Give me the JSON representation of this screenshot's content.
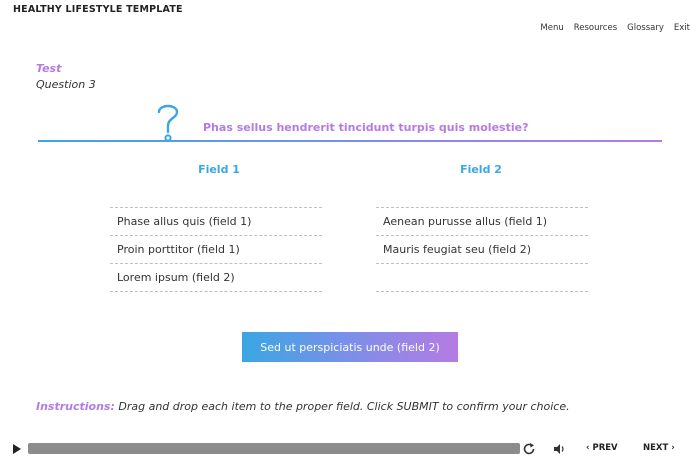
{
  "app": {
    "title": "HEALTHY LIFESTYLE TEMPLATE"
  },
  "nav": {
    "items": [
      "Menu",
      "Resources",
      "Glossary",
      "Exit"
    ]
  },
  "section": {
    "label": "Test",
    "question_number": "Question 3"
  },
  "question": {
    "text": "Phas sellus hendrerit tincidunt turpis quis molestie?"
  },
  "fields": [
    {
      "header": "Field 1",
      "items": [
        "Phase allus quis (field 1)",
        "Proin porttitor (field 1)",
        "Lorem ipsum (field 2)"
      ]
    },
    {
      "header": "Field 2",
      "items": [
        "Aenean purusse allus (field 1)",
        "Mauris feugiat seu (field 2)",
        ""
      ]
    }
  ],
  "drag_item": {
    "label": "Sed ut perspiciatis unde (field 2)"
  },
  "instructions": {
    "label": "Instructions:",
    "text": "Drag and drop each item to the proper field. Click SUBMIT to confirm your choice."
  },
  "player": {
    "prev_label": "PREV",
    "next_label": "NEXT"
  },
  "colors": {
    "accent_blue": "#3aa7e2",
    "accent_purple": "#b57be3"
  }
}
